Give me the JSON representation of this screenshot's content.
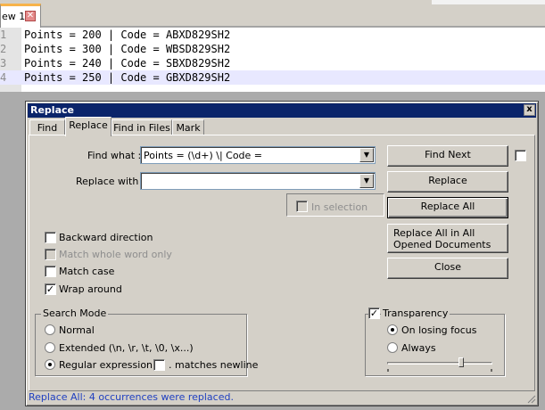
{
  "editor": {
    "tab_title": "ew 1",
    "lines": [
      {
        "num": "1",
        "text": "Points = 200 | Code = ABXD829SH2"
      },
      {
        "num": "2",
        "text": "Points = 300 | Code = WBSD829SH2"
      },
      {
        "num": "3",
        "text": "Points = 240 | Code = SBXD829SH2"
      },
      {
        "num": "4",
        "text": "Points = 250 | Code = GBXD829SH2"
      }
    ],
    "current_line": 4
  },
  "dialog": {
    "title": "Replace",
    "close_glyph": "x",
    "tabs": [
      "Find",
      "Replace",
      "Find in Files",
      "Mark"
    ],
    "active_tab": "Replace",
    "find_what": {
      "label": "Find what :",
      "value": "Points = (\\d+) \\| Code = "
    },
    "replace_with": {
      "label": "Replace with :",
      "value": ""
    },
    "buttons": {
      "find_next": "Find Next",
      "replace": "Replace",
      "replace_all": "Replace All",
      "replace_all_opened": "Replace All in All Opened Documents",
      "close": "Close"
    },
    "in_selection": {
      "label": "In selection",
      "checked": false,
      "enabled": false
    },
    "options": [
      {
        "label": "Backward direction",
        "checked": false,
        "enabled": true
      },
      {
        "label": "Match whole word only",
        "checked": false,
        "enabled": false
      },
      {
        "label": "Match case",
        "checked": false,
        "enabled": true
      },
      {
        "label": "Wrap around",
        "checked": true,
        "enabled": true
      }
    ],
    "search_mode": {
      "title": "Search Mode",
      "modes": [
        "Normal",
        "Extended (\\n, \\r, \\t, \\0, \\x...)",
        "Regular expression"
      ],
      "selected": "Regular expression",
      "matches_newline_label": ". matches newline",
      "matches_newline_checked": false
    },
    "transparency": {
      "label": "Transparency",
      "checked": true,
      "options": [
        "On losing focus",
        "Always"
      ],
      "selected": "On losing focus",
      "level_fraction": 0.7
    },
    "status": "Replace All: 4 occurrences were replaced."
  },
  "colors": {
    "title_bar": "#0a246a",
    "dialog_bg": "#d4d0c8",
    "status_text": "#2040c0",
    "current_line_bg": "#e8e8ff"
  }
}
